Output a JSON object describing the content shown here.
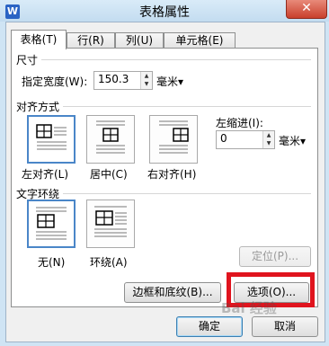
{
  "window": {
    "title": "表格属性",
    "app_icon_letter": "W",
    "close_glyph": "✕",
    "title_bg_color": "#c3dcf0",
    "highlight_color": "#e0141e"
  },
  "tabs": [
    {
      "label": "表格(T)",
      "active": true
    },
    {
      "label": "行(R)",
      "active": false
    },
    {
      "label": "列(U)",
      "active": false
    },
    {
      "label": "单元格(E)",
      "active": false
    }
  ],
  "size_section": {
    "title": "尺寸",
    "width_label": "指定宽度(W):",
    "width_value": "150.3",
    "unit": "毫米▾"
  },
  "align_section": {
    "title": "对齐方式",
    "options": [
      {
        "label": "左对齐(L)",
        "selected": true
      },
      {
        "label": "居中(C)",
        "selected": false
      },
      {
        "label": "右对齐(H)",
        "selected": false
      }
    ],
    "indent_label": "左缩进(I):",
    "indent_value": "0",
    "indent_unit": "毫米▾"
  },
  "wrap_section": {
    "title": "文字环绕",
    "options": [
      {
        "label": "无(N)",
        "selected": true
      },
      {
        "label": "环绕(A)",
        "selected": false
      }
    ],
    "position_button": "定位(P)..."
  },
  "buttons": {
    "borders": "边框和底纹(B)...",
    "options": "选项(O)...",
    "ok": "确定",
    "cancel": "取消"
  },
  "watermark_text": "Bai 经验"
}
